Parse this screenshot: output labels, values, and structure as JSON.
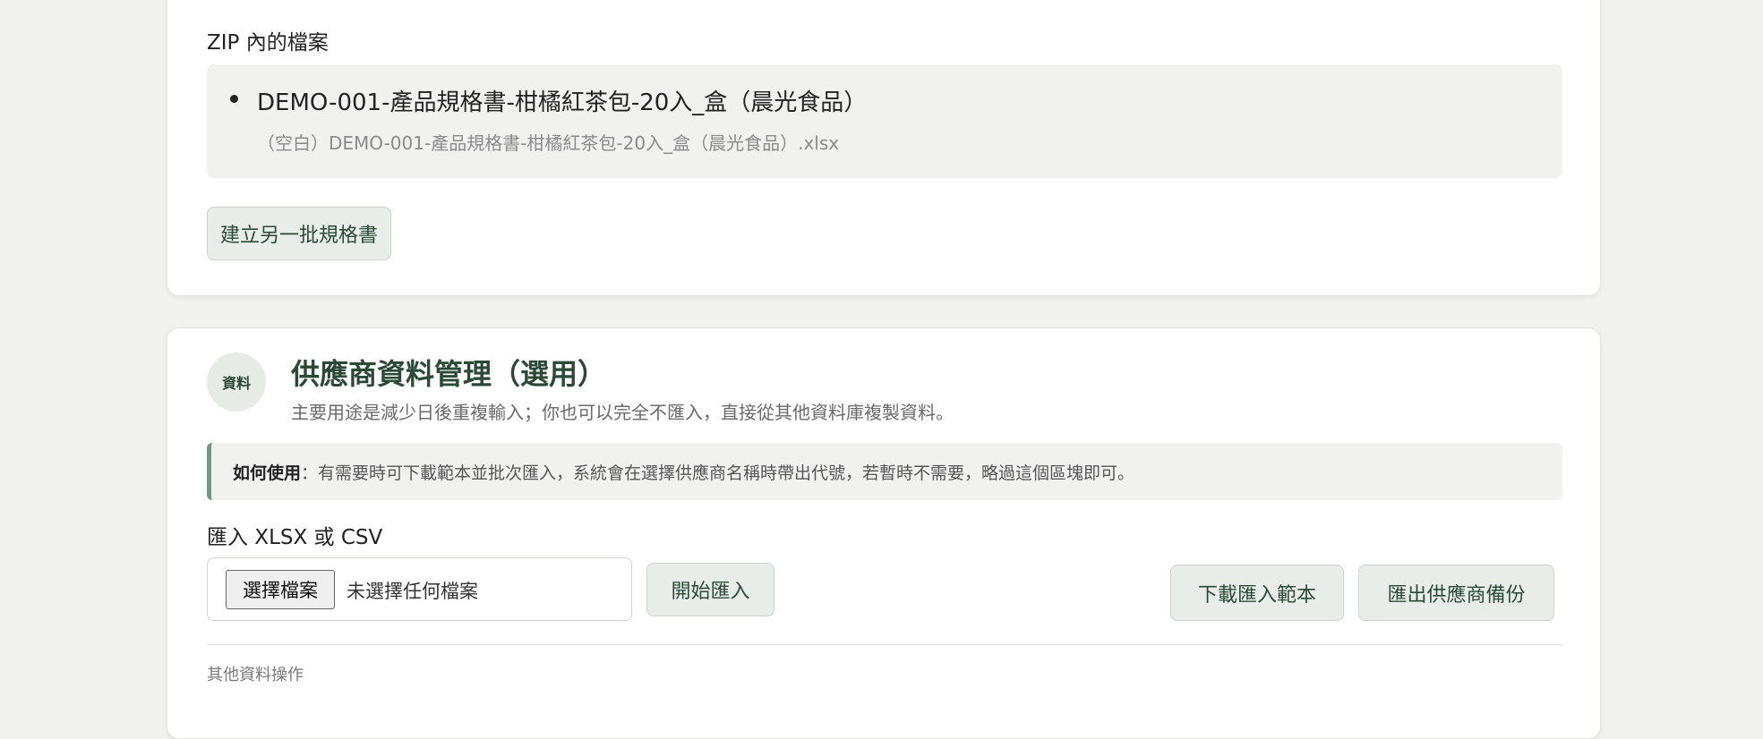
{
  "zip_section": {
    "label": "ZIP 內的檔案",
    "files": [
      {
        "name": "DEMO-001-產品規格書-柑橘紅茶包-20入_盒（晨光食品）",
        "detail": "（空白）DEMO-001-產品規格書-柑橘紅茶包-20入_盒（晨光食品）.xlsx"
      }
    ],
    "new_batch_button": "建立另一批規格書"
  },
  "supplier_section": {
    "badge": "資料",
    "title": "供應商資料管理（選用）",
    "description": "主要用途是減少日後重複輸入；你也可以完全不匯入，直接從其他資料庫複製資料。",
    "howto_label": "如何使用",
    "howto_text": "：有需要時可下載範本並批次匯入，系統會在選擇供應商名稱時帶出代號，若暫時不需要，略過這個區塊即可。",
    "import_label": "匯入 XLSX 或 CSV",
    "choose_file_button": "選擇檔案",
    "no_file_text": "未選擇任何檔案",
    "start_import_button": "開始匯入",
    "download_template_button": "下載匯入範本",
    "export_backup_button": "匯出供應商備份",
    "other_actions_label": "其他資料操作"
  },
  "colors": {
    "page_bg": "#f1f1ef",
    "accent_green": "#2a4a36",
    "howto_border": "#6f9a7e"
  }
}
